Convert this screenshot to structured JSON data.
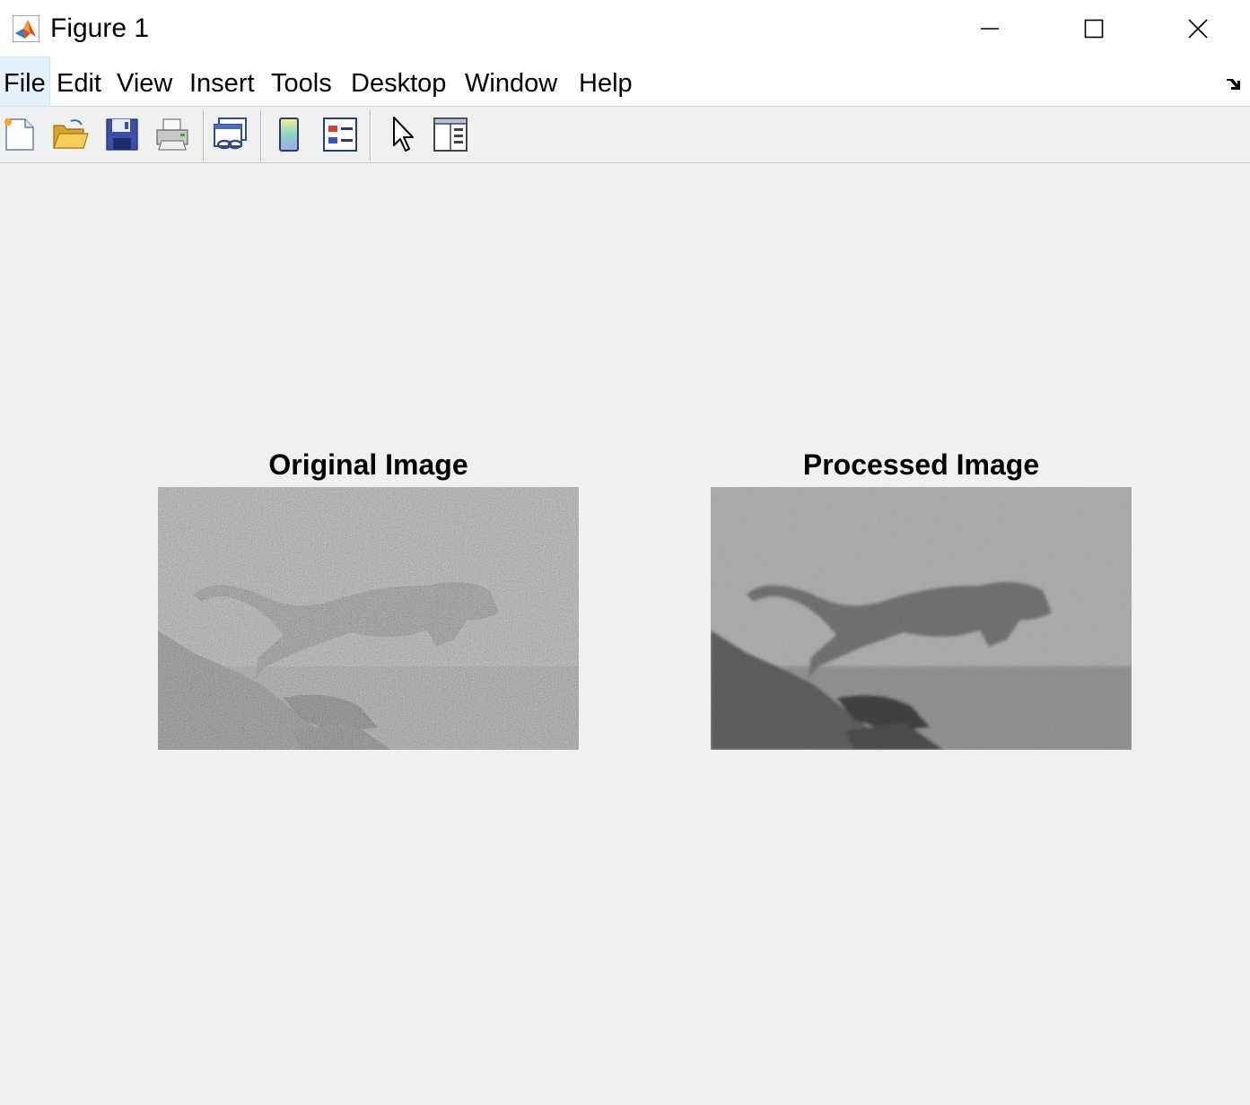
{
  "window": {
    "title": "Figure 1"
  },
  "menu": {
    "items": [
      {
        "label": "File"
      },
      {
        "label": "Edit"
      },
      {
        "label": "View"
      },
      {
        "label": "Insert"
      },
      {
        "label": "Tools"
      },
      {
        "label": "Desktop"
      },
      {
        "label": "Window"
      },
      {
        "label": "Help"
      }
    ]
  },
  "toolbar": {
    "icons": [
      "new-figure-icon",
      "open-file-icon",
      "save-icon",
      "print-icon",
      "link-plot-icon",
      "insert-colorbar-icon",
      "insert-legend-icon",
      "edit-plot-icon",
      "property-inspector-icon"
    ]
  },
  "axes": [
    {
      "title": "Original Image"
    },
    {
      "title": "Processed Image"
    }
  ],
  "colors": {
    "figure_bg": "#f0f0f0",
    "menu_active": "#e5f1fb"
  }
}
